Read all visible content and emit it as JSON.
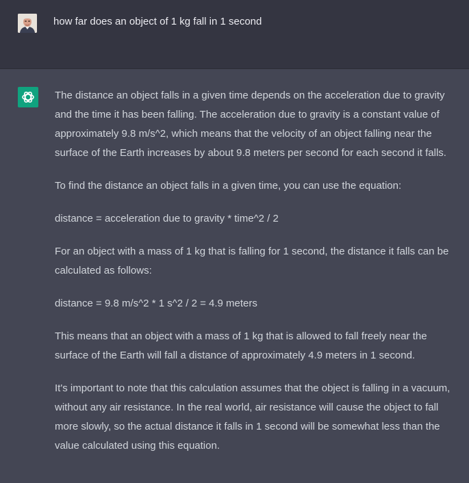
{
  "user_message": {
    "text": "how far does an object of 1 kg fall in 1 second"
  },
  "assistant_message": {
    "paragraphs": [
      "The distance an object falls in a given time depends on the acceleration due to gravity and the time it has been falling. The acceleration due to gravity is a constant value of approximately 9.8 m/s^2, which means that the velocity of an object falling near the surface of the Earth increases by about 9.8 meters per second for each second it falls.",
      "To find the distance an object falls in a given time, you can use the equation:",
      "distance = acceleration due to gravity * time^2 / 2",
      "For an object with a mass of 1 kg that is falling for 1 second, the distance it falls can be calculated as follows:",
      "distance = 9.8 m/s^2 * 1 s^2 / 2 = 4.9 meters",
      "This means that an object with a mass of 1 kg that is allowed to fall freely near the surface of the Earth will fall a distance of approximately 4.9 meters in 1 second.",
      "It's important to note that this calculation assumes that the object is falling in a vacuum, without any air resistance. In the real world, air resistance will cause the object to fall more slowly, so the actual distance it falls in 1 second will be somewhat less than the value calculated using this equation."
    ]
  },
  "colors": {
    "user_row_bg": "#343541",
    "assistant_row_bg": "#444654",
    "assistant_avatar_bg": "#10a37f",
    "text": "#d1d5db"
  },
  "icons": {
    "user_avatar": "user-photo-avatar",
    "assistant_avatar": "openai-logo-icon"
  }
}
